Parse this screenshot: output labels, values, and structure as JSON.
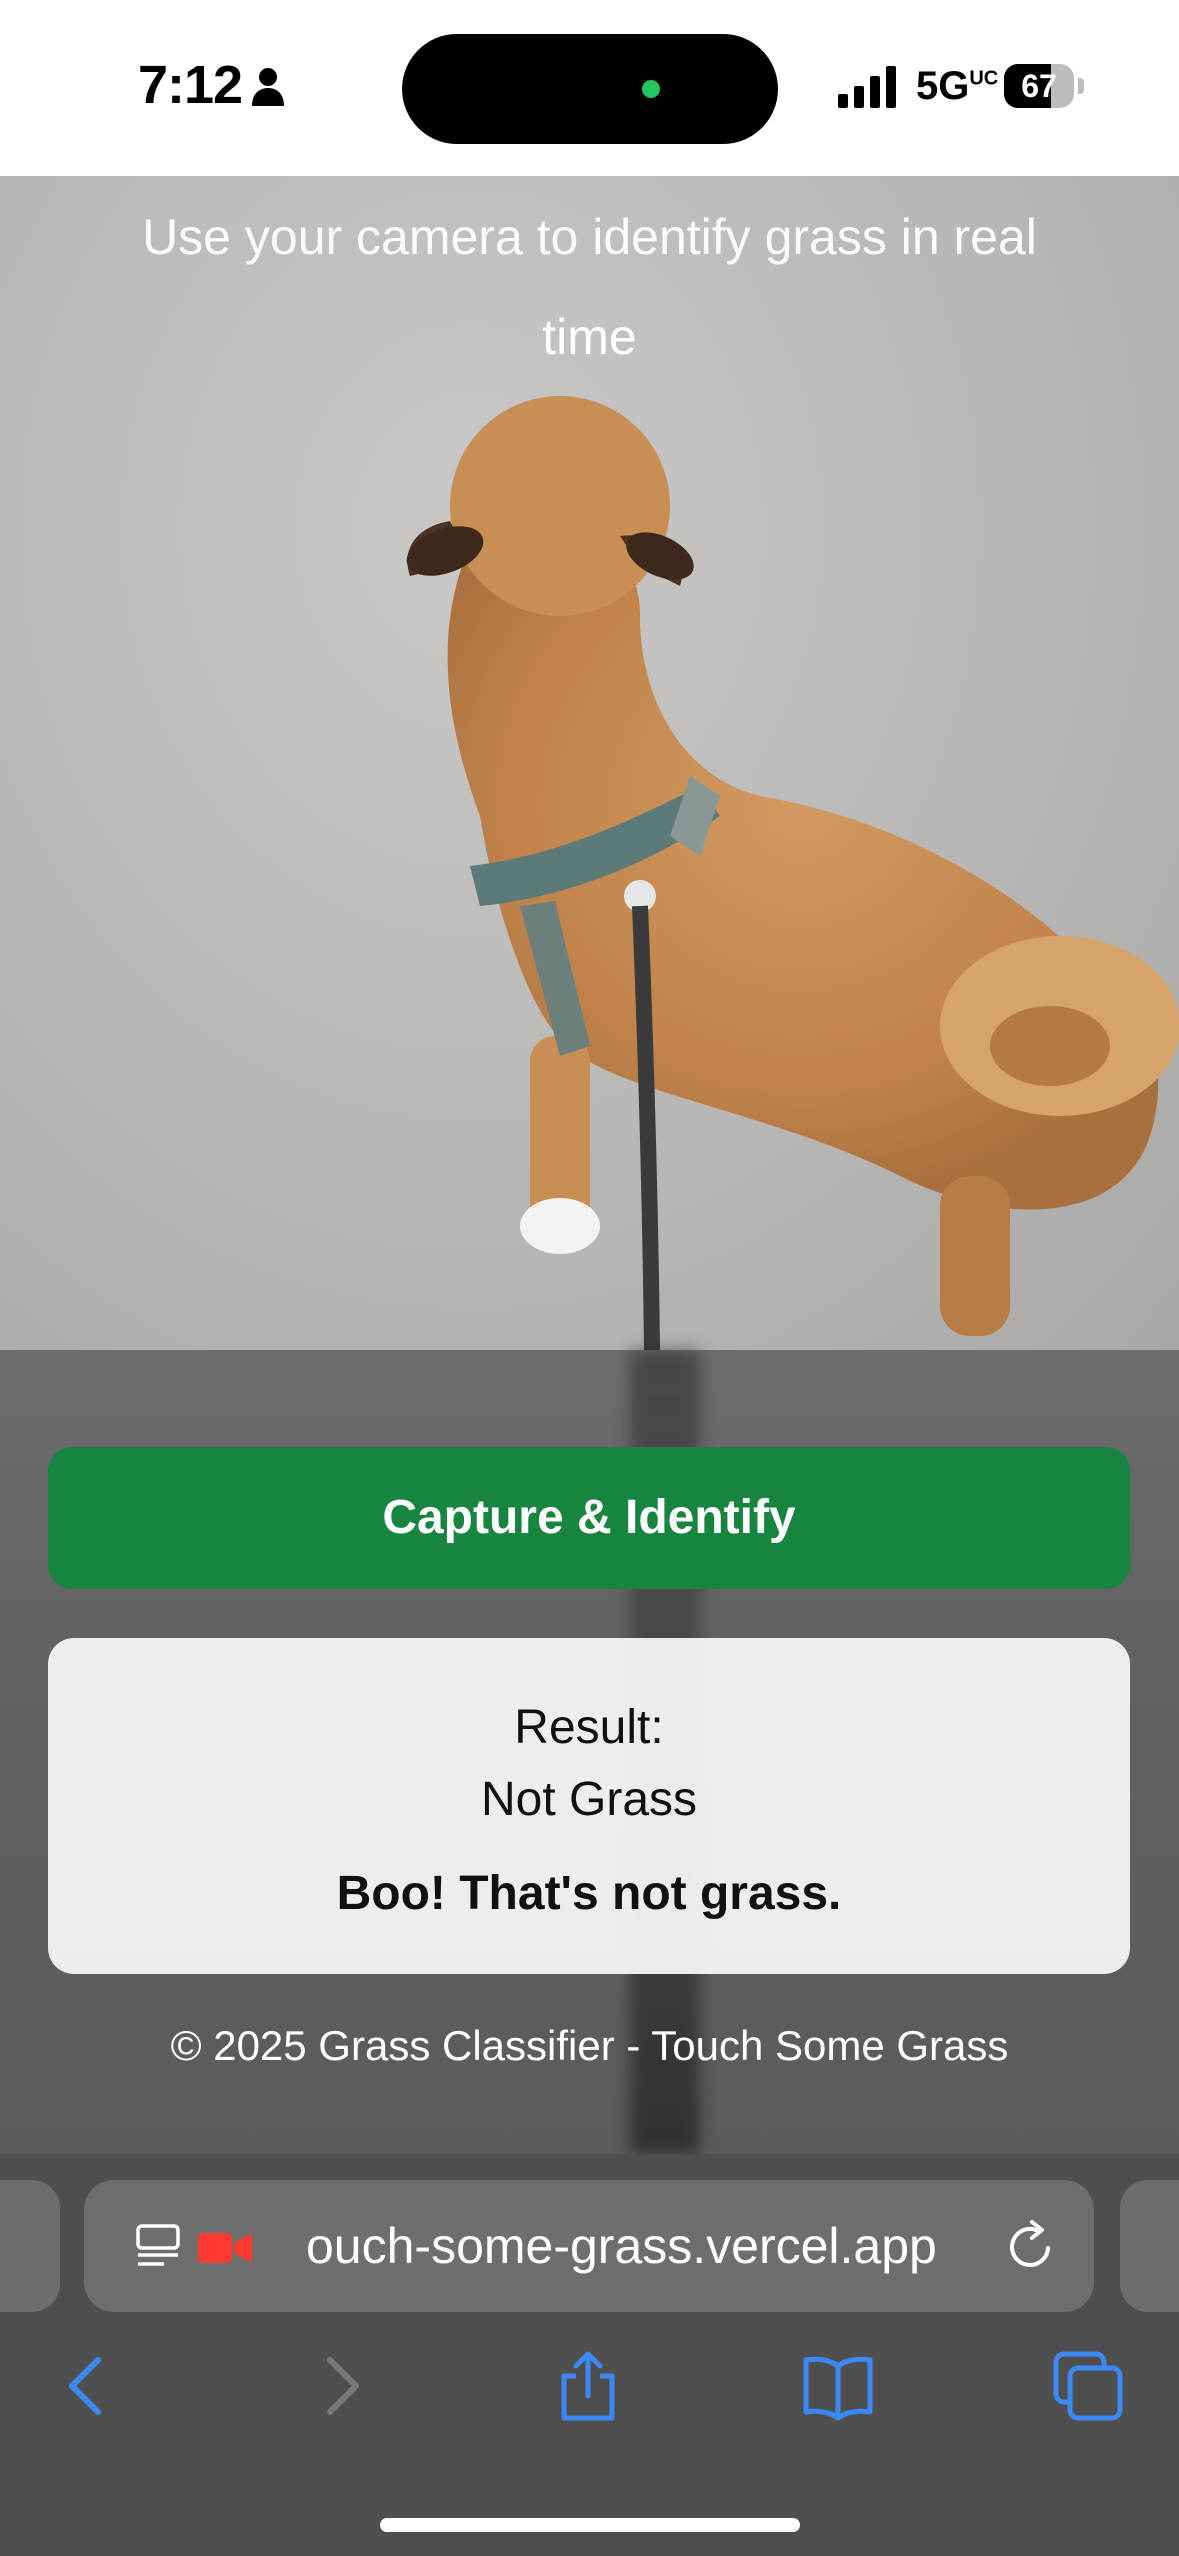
{
  "status_bar": {
    "time": "7:12",
    "network": "5G",
    "network_superscript": "UC",
    "battery_level": "67",
    "battery_fraction": 0.67,
    "icons": [
      "person-icon",
      "signal-icon",
      "battery-icon"
    ],
    "island_indicator_color": "#22c55e"
  },
  "camera": {
    "subtitle_line1": "Use your camera to identify grass in real",
    "subtitle_line2": "time"
  },
  "app": {
    "capture_button_label": "Capture & Identify",
    "result_label": "Result:",
    "result_value": "Not Grass",
    "result_message": "Boo! That's not grass.",
    "footer": "© 2025 Grass Classifier - Touch Some Grass",
    "accent_color": "#178540"
  },
  "browser": {
    "url": "ouch-some-grass.vercel.app",
    "icons": [
      "reader-icon",
      "camera-recording-icon",
      "reload-icon"
    ],
    "nav_icons": [
      "back-icon",
      "forward-icon",
      "share-icon",
      "bookmarks-icon",
      "tabs-icon"
    ],
    "nav_color": "#3d8af7"
  }
}
